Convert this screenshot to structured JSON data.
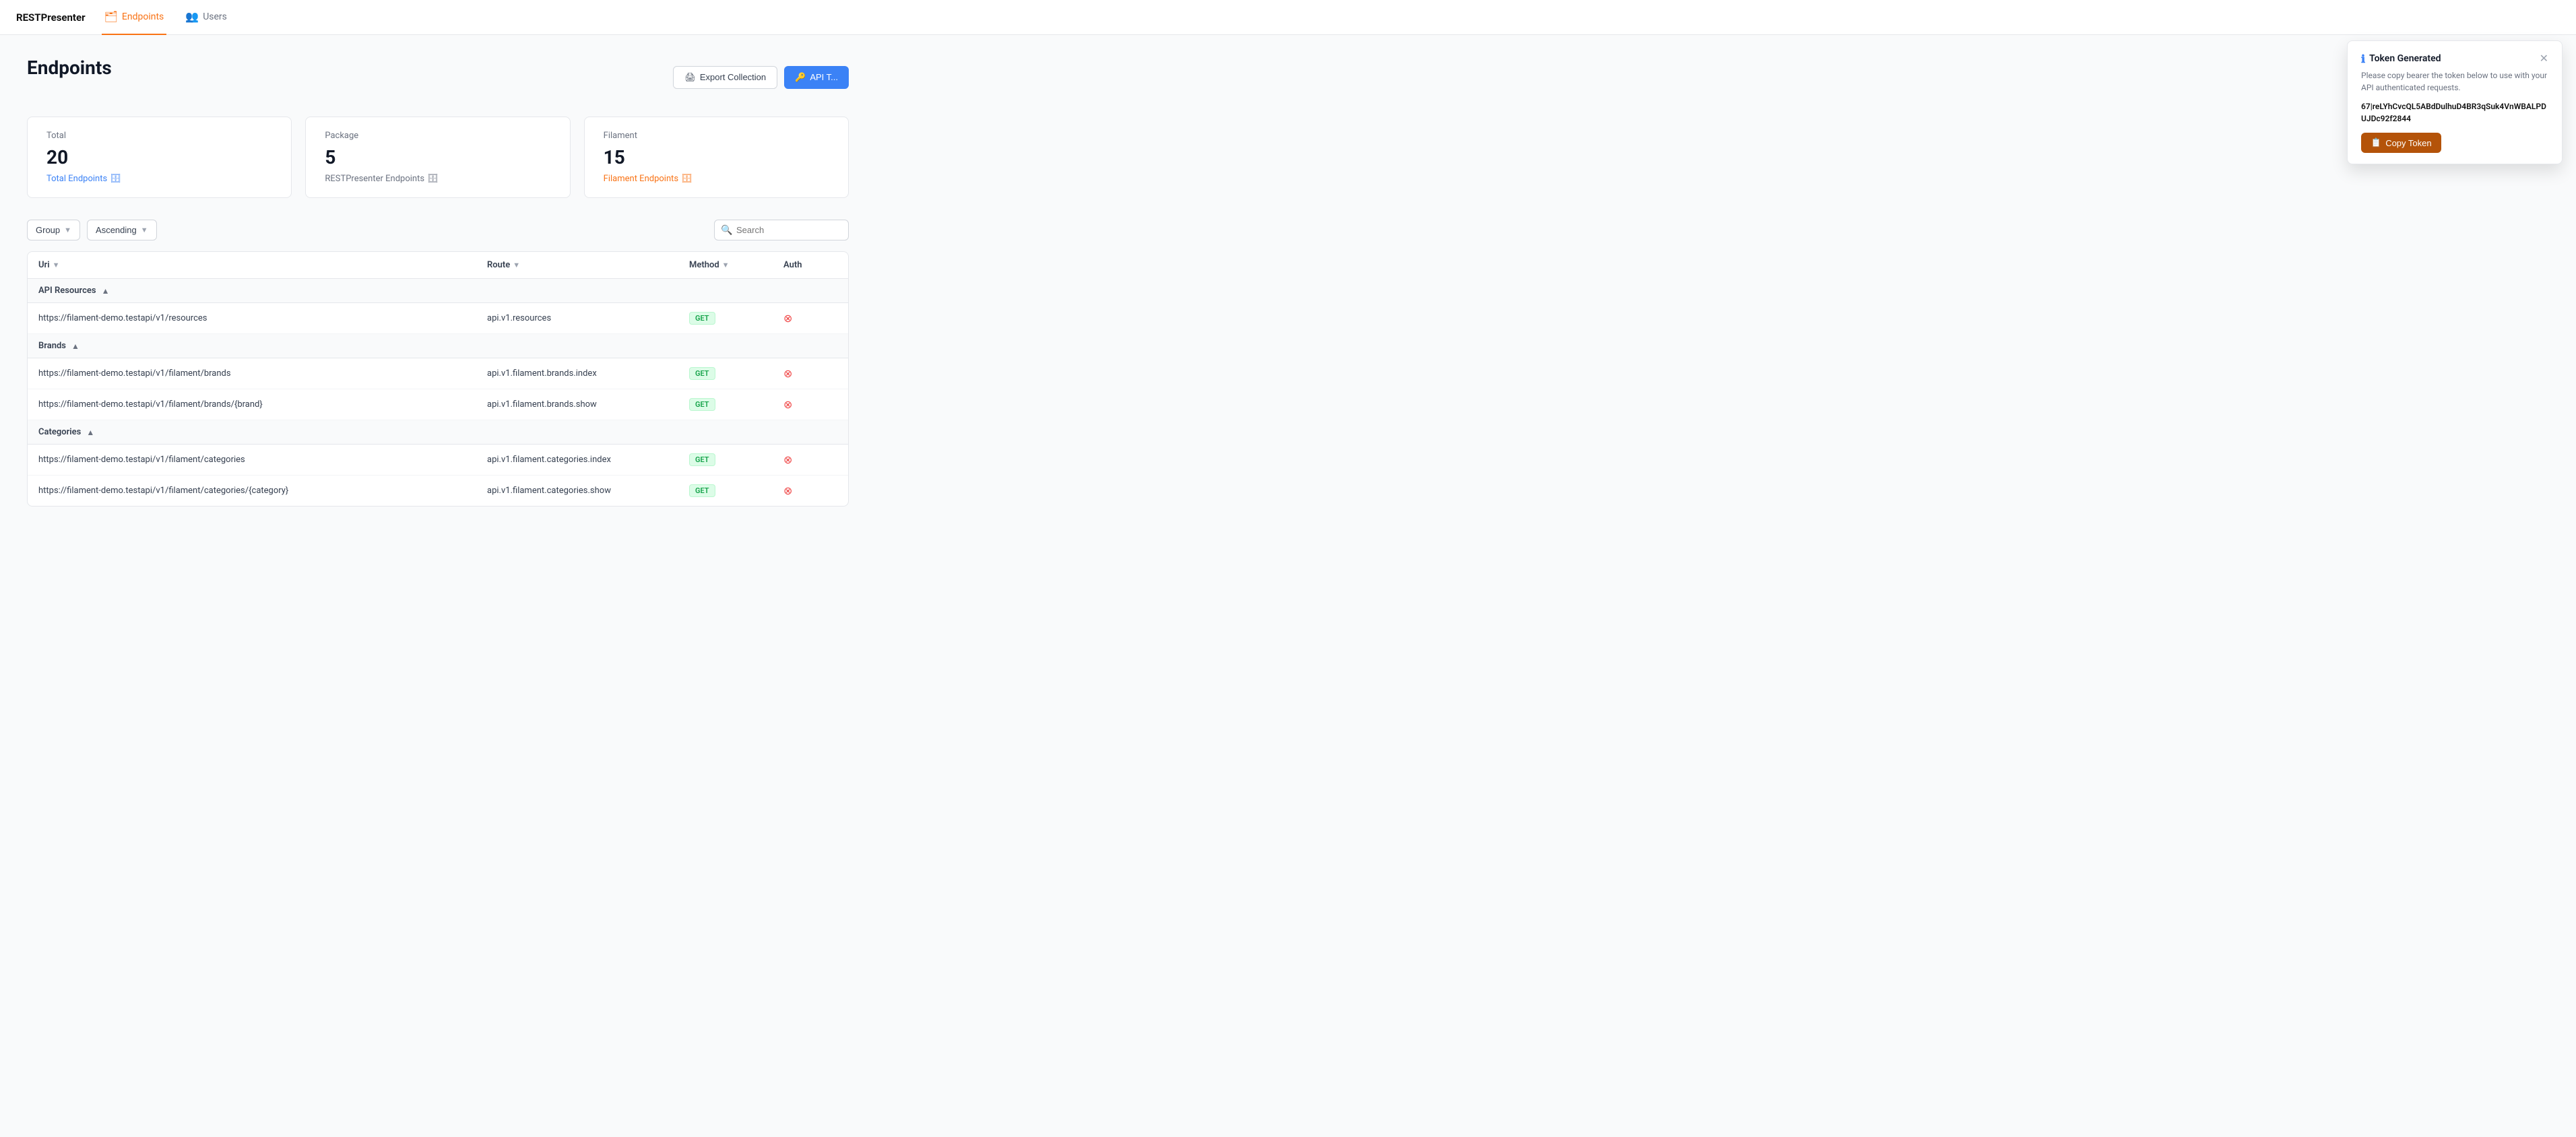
{
  "app": {
    "brand": "RESTPresenter"
  },
  "nav": {
    "items": [
      {
        "id": "endpoints",
        "label": "Endpoints",
        "active": true,
        "icon": "🗂"
      },
      {
        "id": "users",
        "label": "Users",
        "active": false,
        "icon": "👥"
      }
    ]
  },
  "page": {
    "title": "Endpoints"
  },
  "header_actions": {
    "export_label": "Export Collection",
    "api_label": "API T..."
  },
  "stats": [
    {
      "id": "total",
      "label": "Total",
      "value": "20",
      "link_label": "Total Endpoints",
      "link_color": "blue"
    },
    {
      "id": "package",
      "label": "Package",
      "value": "5",
      "link_label": "RESTPresenter Endpoints",
      "link_color": "gray"
    },
    {
      "id": "filament",
      "label": "Filament",
      "value": "15",
      "link_label": "Filament Endpoints",
      "link_color": "orange"
    }
  ],
  "toolbar": {
    "group_label": "Group",
    "ascending_label": "Ascending",
    "search_placeholder": "Search"
  },
  "table": {
    "headers": [
      {
        "id": "uri",
        "label": "Uri",
        "sort": true
      },
      {
        "id": "route",
        "label": "Route",
        "sort": true
      },
      {
        "id": "method",
        "label": "Method",
        "sort": true
      },
      {
        "id": "auth",
        "label": "Auth",
        "sort": false
      }
    ],
    "groups": [
      {
        "name": "API Resources",
        "rows": [
          {
            "uri": "https://filament-demo.testapi/v1/resources",
            "route": "api.v1.resources",
            "method": "GET",
            "auth": "circle-x"
          }
        ]
      },
      {
        "name": "Brands",
        "rows": [
          {
            "uri": "https://filament-demo.testapi/v1/filament/brands",
            "route": "api.v1.filament.brands.index",
            "method": "GET",
            "auth": "circle-x"
          },
          {
            "uri": "https://filament-demo.testapi/v1/filament/brands/{brand}",
            "route": "api.v1.filament.brands.show",
            "method": "GET",
            "auth": "circle-x"
          }
        ]
      },
      {
        "name": "Categories",
        "rows": [
          {
            "uri": "https://filament-demo.testapi/v1/filament/categories",
            "route": "api.v1.filament.categories.index",
            "method": "GET",
            "auth": "circle-x"
          },
          {
            "uri": "https://filament-demo.testapi/v1/filament/categories/{category}",
            "route": "api.v1.filament.categories.show",
            "method": "GET",
            "auth": "circle-x"
          }
        ]
      }
    ]
  },
  "toast": {
    "title": "Token Generated",
    "description": "Please copy bearer the token below to use with your API authenticated requests.",
    "token": "67|reLYhCvcQL5ABdDulhuD4BR3qSuk4VnWBALPDUJDc92f2844",
    "copy_label": "Copy Token"
  }
}
